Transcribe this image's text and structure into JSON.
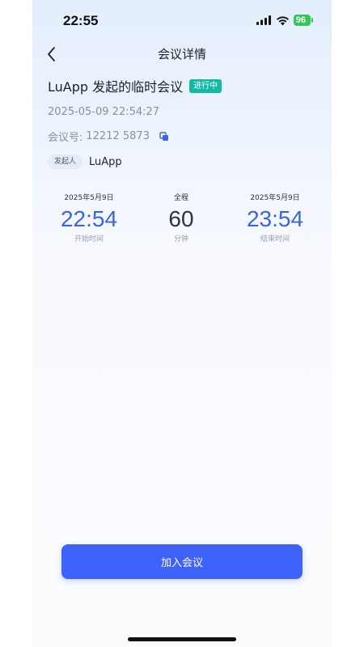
{
  "status_bar": {
    "time": "22:55",
    "battery": "96",
    "signal_icon": "signal-icon",
    "wifi_icon": "wifi-icon"
  },
  "nav": {
    "title": "会议详情",
    "back_icon": "chevron-left-icon"
  },
  "meeting": {
    "title": "LuApp 发起的临时会议",
    "status": "进行中",
    "status_color": "#14b8a6",
    "datetime": "2025-05-09 22:54:27",
    "id_label": "会议号:",
    "id_value": "12212 5873",
    "copy_icon": "copy-icon",
    "host_tag": "发起人",
    "host_name": "LuApp"
  },
  "time_summary": {
    "start": {
      "date": "2025年5月9日",
      "time": "22:54",
      "label": "开始时间"
    },
    "duration": {
      "label_top": "全程",
      "value": "60",
      "unit": "分钟"
    },
    "end": {
      "date": "2025年5月9日",
      "time": "23:54",
      "label": "结束时间"
    }
  },
  "actions": {
    "join_label": "加入会议",
    "join_color": "#3d63fb"
  },
  "accent_color": "#3a64e6"
}
